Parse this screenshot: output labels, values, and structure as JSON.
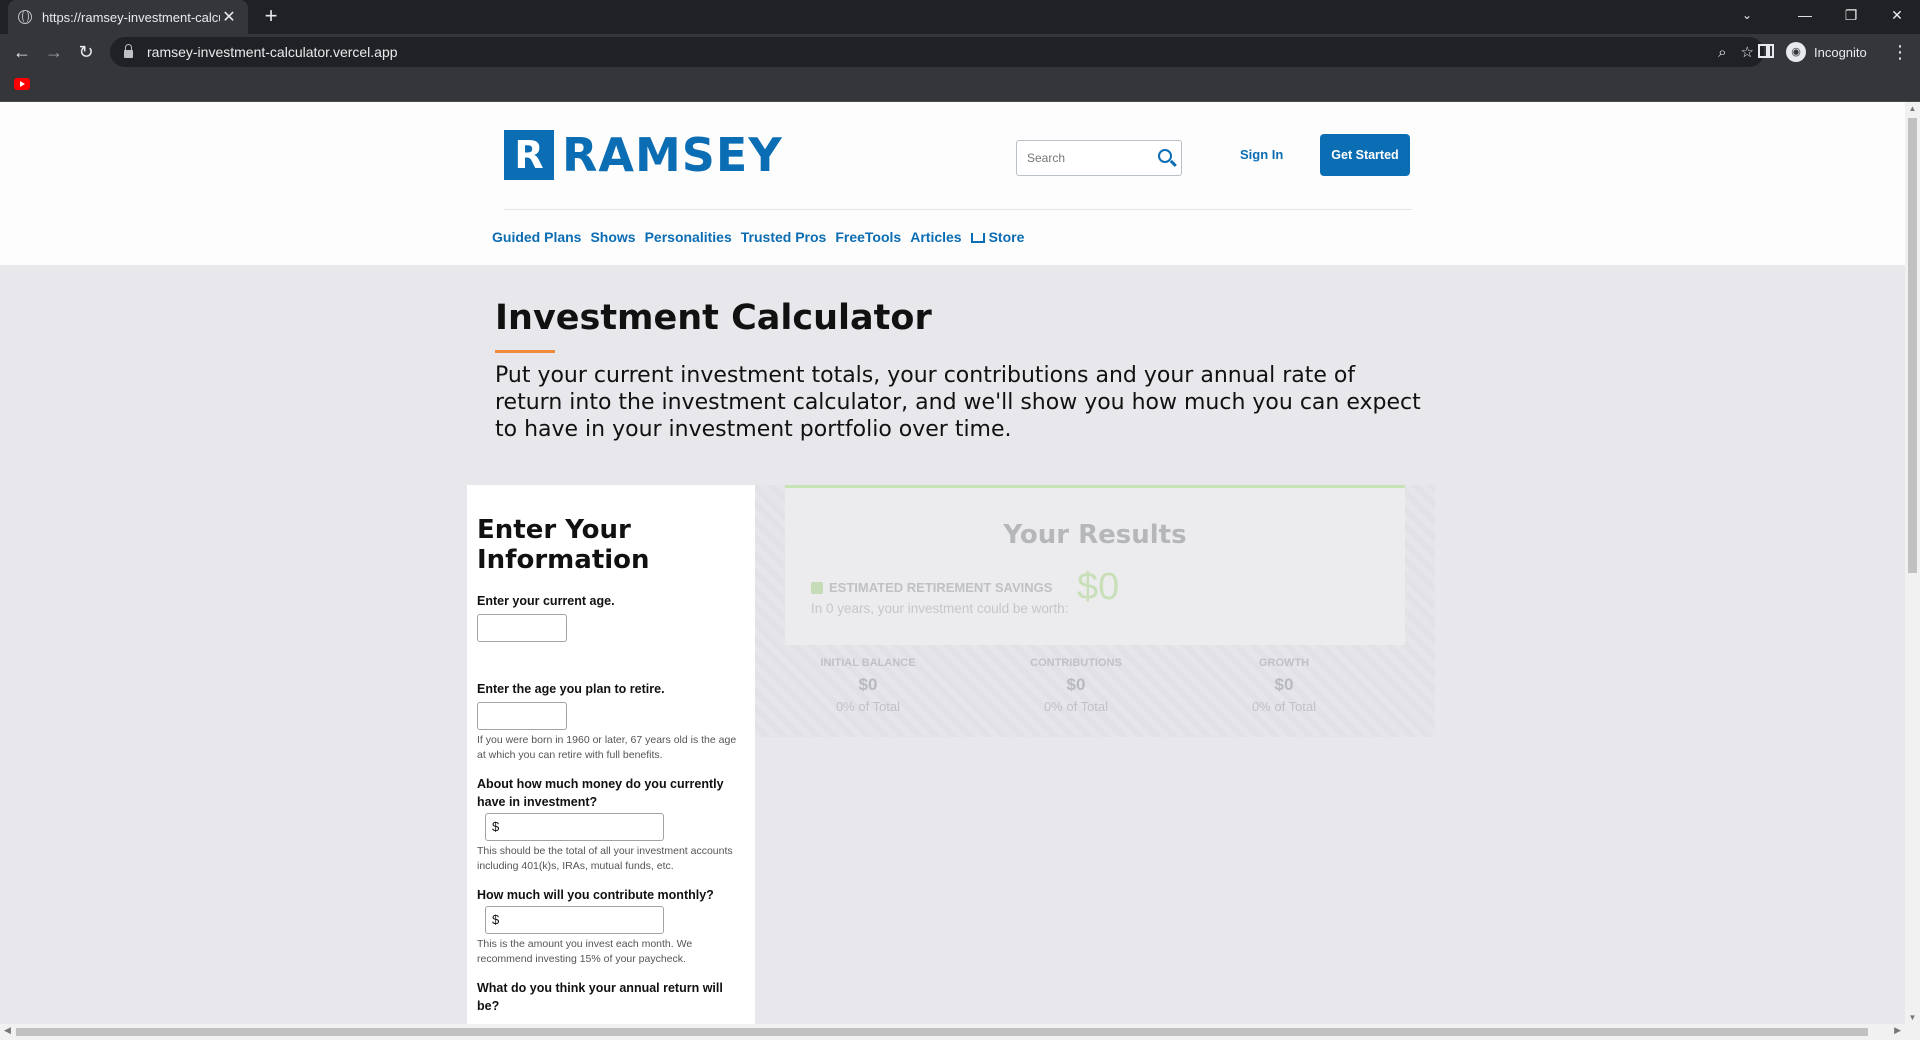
{
  "browser": {
    "tab_title": "https://ramsey-investment-calcul",
    "url": "ramsey-investment-calculator.vercel.app",
    "profile_label": "Incognito"
  },
  "header": {
    "logo_mark": "R",
    "logo_text": "RAMSEY",
    "search_placeholder": "Search",
    "sign_in": "Sign In",
    "get_started": "Get Started",
    "nav": [
      "Guided Plans",
      "Shows",
      "Personalities",
      "Trusted Pros",
      "FreeTools",
      "Articles",
      "Store"
    ]
  },
  "page": {
    "title": "Investment Calculator",
    "intro": "Put your current investment totals, your contributions and your annual rate of return into the investment calculator, and we'll show you how much you can expect to have in your investment portfolio over time."
  },
  "form": {
    "title": "Enter Your Information",
    "q_age": "Enter your current age.",
    "q_retire": "Enter the age you plan to retire.",
    "retire_hint": "If you were born in 1960 or later, 67 years old is the age at which you can retire with full benefits.",
    "q_current": "About how much money do you currently have in investment?",
    "currency_prefix": "$",
    "current_hint": "This should be the total of all your investment accounts including 401(k)s, IRAs, mutual funds, etc.",
    "q_monthly": "How much will you contribute monthly?",
    "monthly_hint": "This is the amount you invest each month. We recommend investing 15% of your paycheck.",
    "q_return": "What do you think your annual return will be?"
  },
  "results": {
    "title": "Your Results",
    "est_label": "ESTIMATED RETIREMENT SAVINGS",
    "est_value": "$0",
    "est_sub": "In 0 years, your investment could be worth:",
    "breakdown": [
      {
        "label": "INITIAL BALANCE",
        "value": "$0",
        "pct": "0% of Total"
      },
      {
        "label": "CONTRIBUTIONS",
        "value": "$0",
        "pct": "0% of Total"
      },
      {
        "label": "GROWTH",
        "value": "$0",
        "pct": "0% of Total"
      }
    ]
  }
}
